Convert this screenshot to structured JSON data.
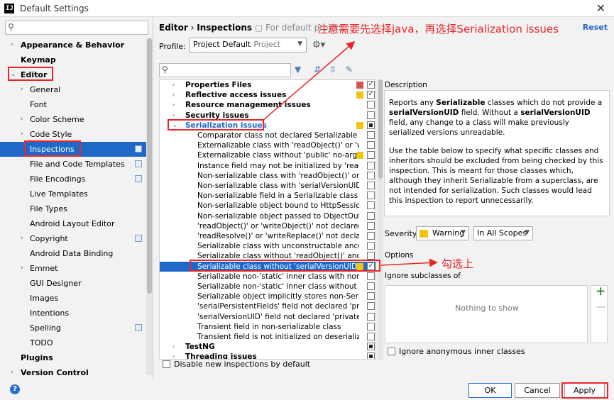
{
  "window": {
    "title": "Default Settings",
    "app_icon_text": "IJ",
    "close_glyph": "✕"
  },
  "sidebar": {
    "search_placeholder": "",
    "items": [
      {
        "label": "Appearance & Behavior",
        "bold": true,
        "arrow": "›"
      },
      {
        "label": "Keymap",
        "bold": true,
        "arrow": ""
      },
      {
        "label": "Editor",
        "bold": true,
        "arrow": "⌄"
      },
      {
        "label": "General",
        "bold": false,
        "arrow": "›"
      },
      {
        "label": "Font",
        "bold": false,
        "arrow": ""
      },
      {
        "label": "Color Scheme",
        "bold": false,
        "arrow": "›"
      },
      {
        "label": "Code Style",
        "bold": false,
        "arrow": "›"
      },
      {
        "label": "Inspections",
        "bold": false,
        "arrow": ""
      },
      {
        "label": "File and Code Templates",
        "bold": false,
        "arrow": ""
      },
      {
        "label": "File Encodings",
        "bold": false,
        "arrow": ""
      },
      {
        "label": "Live Templates",
        "bold": false,
        "arrow": ""
      },
      {
        "label": "File Types",
        "bold": false,
        "arrow": ""
      },
      {
        "label": "Android Layout Editor",
        "bold": false,
        "arrow": ""
      },
      {
        "label": "Copyright",
        "bold": false,
        "arrow": "›"
      },
      {
        "label": "Android Data Binding",
        "bold": false,
        "arrow": ""
      },
      {
        "label": "Emmet",
        "bold": false,
        "arrow": "›"
      },
      {
        "label": "GUI Designer",
        "bold": false,
        "arrow": ""
      },
      {
        "label": "Images",
        "bold": false,
        "arrow": ""
      },
      {
        "label": "Intentions",
        "bold": false,
        "arrow": ""
      },
      {
        "label": "Spelling",
        "bold": false,
        "arrow": ""
      },
      {
        "label": "TODO",
        "bold": false,
        "arrow": ""
      },
      {
        "label": "Plugins",
        "bold": true,
        "arrow": ""
      },
      {
        "label": "Version Control",
        "bold": true,
        "arrow": "›"
      }
    ]
  },
  "header": {
    "bc_editor": "Editor",
    "bc_sep": "›",
    "bc_page": "Inspections",
    "bc_scope": "For default project",
    "reset": "Reset",
    "profile_label": "Profile:",
    "profile_value": "Project Default",
    "profile_sub": "Project"
  },
  "annotations": {
    "top_note": "注意需要先选择java，再选择Serialization issues",
    "check_note": "勾选上"
  },
  "colors": {
    "accent": "#1e69c8",
    "annotation": "#e8262b",
    "warning": "#f2c511",
    "error": "#d9534f"
  },
  "inspections": [
    {
      "label": "Properties Files",
      "group": true,
      "arrow": "›",
      "sev": "#d9534f",
      "check": "✓"
    },
    {
      "label": "Reflective access issues",
      "group": true,
      "arrow": "›",
      "sev": "#f2c511",
      "check": "✓"
    },
    {
      "label": "Resource management issues",
      "group": true,
      "arrow": "›",
      "sev": "",
      "check": ""
    },
    {
      "label": "Security issues",
      "group": true,
      "arrow": "›",
      "sev": "",
      "check": ""
    },
    {
      "label": "Serialization issues",
      "group": true,
      "arrow": "⌄",
      "sev": "#f2c511",
      "check": "partial"
    },
    {
      "label": "Comparator class not declared Serializable",
      "group": false,
      "arrow": "",
      "sev": "",
      "check": ""
    },
    {
      "label": "Externalizable class with 'readObject()' or 'wri",
      "group": false,
      "arrow": "",
      "sev": "",
      "check": ""
    },
    {
      "label": "Externalizable class without 'public' no-arg co",
      "group": false,
      "arrow": "",
      "sev": "#f2c511",
      "check": ""
    },
    {
      "label": "Instance field may not be initialized by 'readO",
      "group": false,
      "arrow": "",
      "sev": "",
      "check": ""
    },
    {
      "label": "Non-serializable class with 'readObject()' or 'w",
      "group": false,
      "arrow": "",
      "sev": "",
      "check": ""
    },
    {
      "label": "Non-serializable class with 'serialVersionUID'",
      "group": false,
      "arrow": "",
      "sev": "",
      "check": ""
    },
    {
      "label": "Non-serializable field in a Serializable class",
      "group": false,
      "arrow": "",
      "sev": "",
      "check": ""
    },
    {
      "label": "Non-serializable object bound to HttpSession",
      "group": false,
      "arrow": "",
      "sev": "",
      "check": ""
    },
    {
      "label": "Non-serializable object passed to ObjectOutp",
      "group": false,
      "arrow": "",
      "sev": "",
      "check": ""
    },
    {
      "label": "'readObject()' or 'writeObject()' not declared",
      "group": false,
      "arrow": "",
      "sev": "",
      "check": ""
    },
    {
      "label": "'readResolve()' or 'writeReplace()' not declare",
      "group": false,
      "arrow": "",
      "sev": "",
      "check": ""
    },
    {
      "label": "Serializable class with unconstructable ancest",
      "group": false,
      "arrow": "",
      "sev": "",
      "check": ""
    },
    {
      "label": "Serializable class without 'readObject()' and 'w",
      "group": false,
      "arrow": "",
      "sev": "",
      "check": ""
    },
    {
      "label": "Serializable class without 'serialVersionUID'",
      "group": false,
      "arrow": "",
      "sev": "#f2c511",
      "check": "✓",
      "selected": true
    },
    {
      "label": "Serializable non-'static' inner class with non-S",
      "group": false,
      "arrow": "",
      "sev": "",
      "check": ""
    },
    {
      "label": "Serializable non-'static' inner class without 'se",
      "group": false,
      "arrow": "",
      "sev": "",
      "check": ""
    },
    {
      "label": "Serializable object implicitly stores non-Serial",
      "group": false,
      "arrow": "",
      "sev": "",
      "check": ""
    },
    {
      "label": "'serialPersistentFields' field not declared 'priv",
      "group": false,
      "arrow": "",
      "sev": "",
      "check": ""
    },
    {
      "label": "'serialVersionUID' field not declared 'private",
      "group": false,
      "arrow": "",
      "sev": "",
      "check": ""
    },
    {
      "label": "Transient field in non-serializable class",
      "group": false,
      "arrow": "",
      "sev": "",
      "check": ""
    },
    {
      "label": "Transient field is not initialized on deserializa",
      "group": false,
      "arrow": "",
      "sev": "",
      "check": ""
    },
    {
      "label": "TestNG",
      "group": true,
      "arrow": "›",
      "sev": "",
      "check": "partial"
    },
    {
      "label": "Threading issues",
      "group": true,
      "arrow": "›",
      "sev": "",
      "check": "partial"
    }
  ],
  "disable_new": "Disable new inspections by default",
  "description": {
    "label": "Description",
    "p1_a": "Reports any ",
    "p1_b": "Serializable",
    "p1_c": " classes which do not provide a ",
    "p1_d": "serialVersionUID",
    "p1_e": " field. Without a ",
    "p1_f": "serialVersionUID",
    "p1_g": " field, any change to a class will make previously serialized versions unreadable.",
    "p2": "Use the table below to specify what specific classes and inheritors should be excluded from being checked by this inspection. This is meant for those classes which, although they inherit Serializable from a superclass, are not intended for serialization. Such classes would lead this inspection to report unnecessarily."
  },
  "severity": {
    "label": "Severity:",
    "value": "Warning",
    "scope": "In All Scopes"
  },
  "options": {
    "label": "Options",
    "ignore_label": "Ignore subclasses of",
    "empty": "Nothing to show",
    "ignore_anon": "Ignore anonymous inner classes"
  },
  "buttons": {
    "help": "?",
    "ok": "OK",
    "cancel": "Cancel",
    "apply": "Apply"
  }
}
